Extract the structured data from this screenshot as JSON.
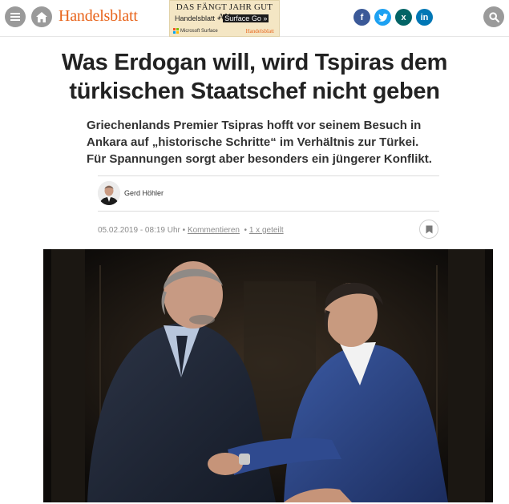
{
  "header": {
    "logo": "Handelsblatt",
    "menu_icon": "menu-icon",
    "home_icon": "home-icon",
    "search_icon": "search-icon"
  },
  "ad": {
    "line1": "DAS FÄNGT JAHR GUT AN",
    "line2_prefix": "Handelsblatt + ",
    "line2_boxed": "Surface Go »",
    "brand_left": "Microsoft Surface",
    "brand_right": "Handelsblatt"
  },
  "social": [
    {
      "label": "f",
      "icon": "facebook-icon"
    },
    {
      "label": "t",
      "icon": "twitter-icon"
    },
    {
      "label": "x",
      "icon": "xing-icon"
    },
    {
      "label": "in",
      "icon": "linkedin-icon"
    }
  ],
  "article": {
    "headline": "Was Erdogan will, wird Tspiras dem türkischen Staatschef nicht geben",
    "teaser": "Griechenlands Premier Tsipras hofft vor seinem Besuch in Ankara auf „historische Schritte“ im Verhältnis zur Türkei. Für Spannungen sorgt aber besonders ein jüngerer Konflikt.",
    "author": "Gerd Höhler",
    "date": "05.02.2019 - 08:19 Uhr",
    "bullet": "•",
    "comments_label": "Kommentieren",
    "shared_label": "1 x geteilt"
  },
  "colors": {
    "brand_orange": "#e8641b",
    "facebook": "#3b5998",
    "twitter": "#1da1f2",
    "xing": "#026466",
    "linkedin": "#0077b5"
  }
}
